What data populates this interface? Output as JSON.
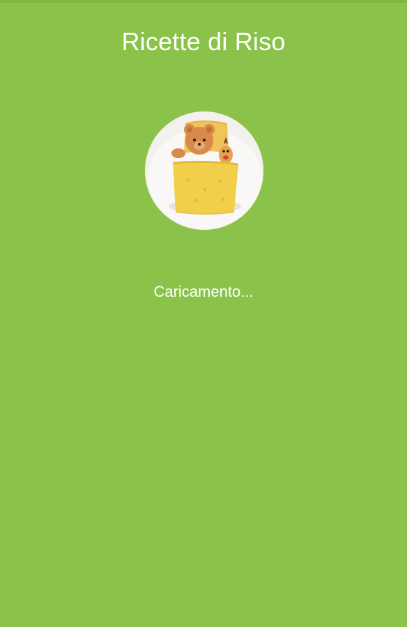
{
  "app": {
    "title": "Ricette di Riso"
  },
  "splash": {
    "image": "bear-rice-omelette-illustration",
    "loading_text": "Caricamento..."
  },
  "colors": {
    "background": "#8bc34a",
    "text": "#ffffff"
  }
}
